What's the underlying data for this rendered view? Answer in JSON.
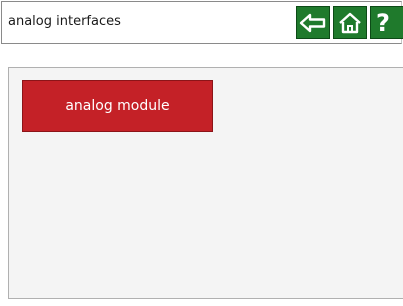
{
  "header": {
    "title": "analog interfaces",
    "back_icon": "arrow-left-icon",
    "home_icon": "home-icon",
    "help_label": "?"
  },
  "main": {
    "module_button_label": "analog module"
  },
  "colors": {
    "nav_green": "#1f7a2c",
    "module_red": "#c42127",
    "panel_bg": "#f4f4f4"
  }
}
